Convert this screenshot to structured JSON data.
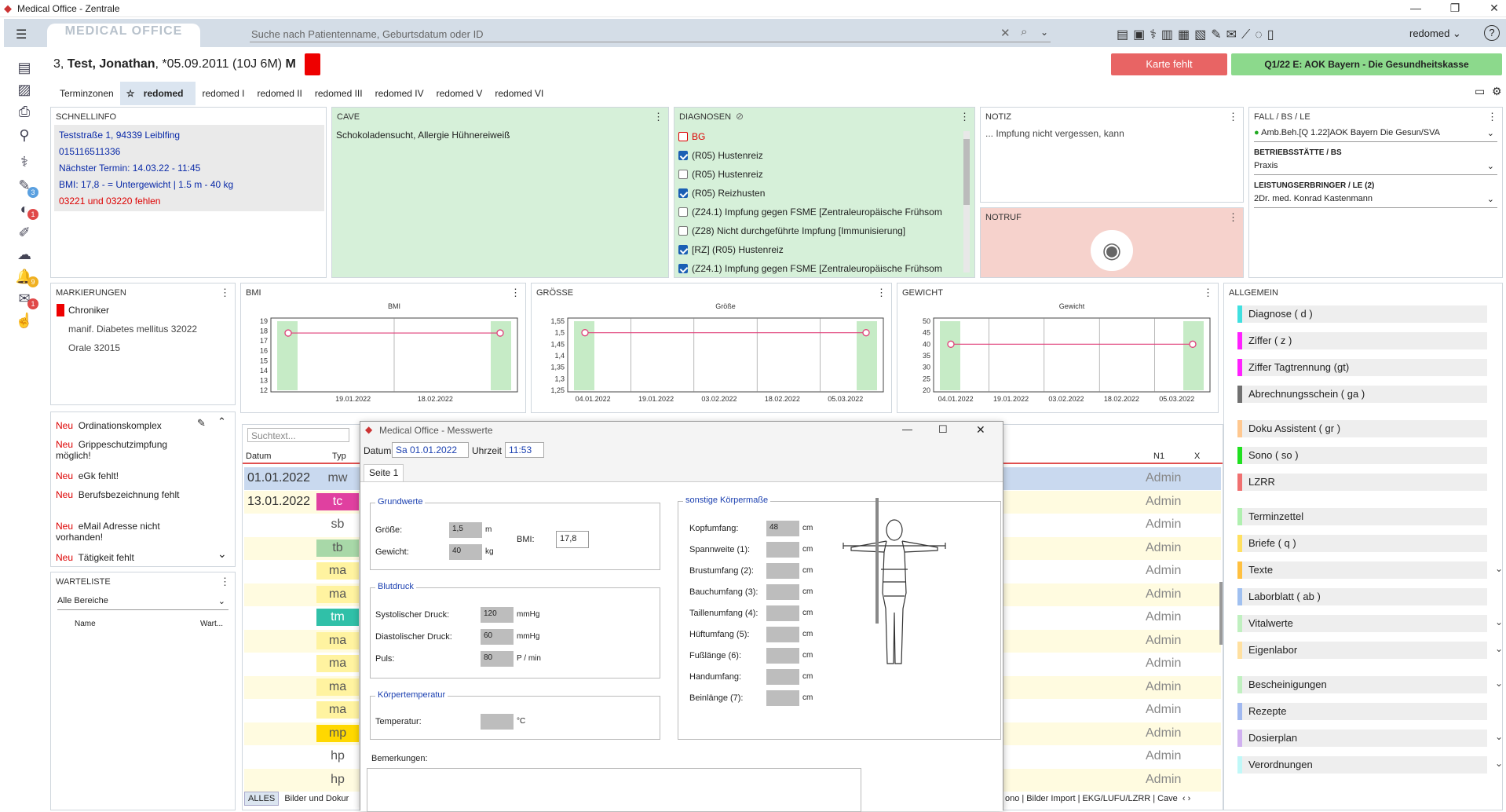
{
  "window": {
    "title": "Medical Office - Zentrale",
    "min": "—",
    "max": "❐",
    "close": "✕"
  },
  "appbar": {
    "menu_icon": "hamburger-icon",
    "logo": "MEDICAL OFFICE",
    "search_placeholder": "Suche nach Patientenname, Geburtsdatum oder ID",
    "user": "redomed ⌄",
    "help": "?"
  },
  "patient": {
    "num": "3,",
    "name": "Test, Jonathan",
    "dob": "*05.09.2011 (10J 6M)",
    "sex": "M",
    "karte": "Karte fehlt",
    "insurance": "Q1/22 E: AOK Bayern - Die Gesundheitskasse"
  },
  "tabs": [
    "Terminzonen",
    "redomed",
    "redomed I",
    "redomed II",
    "redomed III",
    "redomed IV",
    "redomed V",
    "redomed VI"
  ],
  "schnellinfo": {
    "title": "SCHNELLINFO",
    "l1": "Teststraße 1, 94339 Leiblfing",
    "l2": "015116511336",
    "l3": "Nächster Termin: 14.03.22 - 11:45",
    "l4": "BMI: 17,8 -  = Untergewicht | 1.5 m - 40 kg",
    "l5": "03221 und 03220 fehlen"
  },
  "cave": {
    "title": "CAVE",
    "text": "Schokoladensucht, Allergie Hühnereiweiß"
  },
  "diagnosen": {
    "title": "DIAGNOSEN",
    "items": [
      "BG",
      "(R05) Hustenreiz",
      "(R05) Hustenreiz",
      "(R05) Reizhusten",
      "(Z24.1) Impfung gegen FSME [Zentraleuropäische Frühsom",
      "(Z28) Nicht durchgeführte Impfung [Immunisierung]",
      "[RZ] (R05) Hustenreiz",
      "(Z24.1) Impfung gegen FSME [Zentraleuropäische Frühsom"
    ]
  },
  "notiz": {
    "title": "NOTIZ",
    "text": "... Impfung nicht vergessen, kann"
  },
  "notruf": {
    "title": "NOTRUF"
  },
  "fall": {
    "title": "FALL / BS / LE",
    "v1": "Amb.Beh.[Q 1.22]AOK Bayern Die Gesun/SVA",
    "bs_label": "BETRIEBSSTÄTTE / BS",
    "bs": "Praxis",
    "le_label": "LEISTUNGSERBRINGER / LE (2)",
    "le": "2Dr. med. Konrad Kastenmann"
  },
  "markierungen": {
    "title": "MARKIERUNGEN",
    "l1": "Chroniker",
    "l2": "manif. Diabetes mellitus  32022",
    "l3": "Orale  32015"
  },
  "charts": [
    {
      "title": "BMI",
      "inner": "BMI",
      "yticks": [
        "19",
        "18",
        "17",
        "16",
        "15",
        "14",
        "13",
        "12"
      ],
      "xticks": [
        "19.01.2022",
        "18.02.2022"
      ]
    },
    {
      "title": "GRÖßE",
      "inner": "Größe",
      "yticks": [
        "1,55",
        "1,5",
        "1,45",
        "1,4",
        "1,35",
        "1,3",
        "1,25"
      ],
      "xticks": [
        "04.01.2022",
        "19.01.2022",
        "03.02.2022",
        "18.02.2022",
        "05.03.2022"
      ]
    },
    {
      "title": "GEWICHT",
      "inner": "Gewicht",
      "yticks": [
        "50",
        "45",
        "40",
        "35",
        "30",
        "25",
        "20"
      ],
      "xticks": [
        "04.01.2022",
        "19.01.2022",
        "03.02.2022",
        "18.02.2022",
        "05.03.2022"
      ]
    }
  ],
  "chart_data": [
    {
      "type": "line",
      "title": "BMI",
      "y": [
        17.8,
        17.8
      ],
      "ylim": [
        12,
        19
      ]
    },
    {
      "type": "line",
      "title": "Größe",
      "y": [
        1.5,
        1.5
      ],
      "ylim": [
        1.25,
        1.55
      ]
    },
    {
      "type": "line",
      "title": "Gewicht",
      "y": [
        40,
        40
      ],
      "ylim": [
        20,
        50
      ]
    }
  ],
  "neu": [
    {
      "tag": "Neu",
      "text": "Ordinationskomplex"
    },
    {
      "tag": "Neu",
      "text": "Grippeschutzimpfung möglich!"
    },
    {
      "tag": "Neu",
      "text": "eGk fehlt!"
    },
    {
      "tag": "Neu",
      "text": "Berufsbezeichnung fehlt"
    },
    {
      "tag": "Neu",
      "text": "eMail Adresse nicht vorhanden!"
    },
    {
      "tag": "Neu",
      "text": "Tätigkeit fehlt"
    }
  ],
  "warteliste": {
    "title": "WARTELISTE",
    "filter": "Alle Bereiche",
    "col1": "Name",
    "col2": "Wart..."
  },
  "table": {
    "search": "Suchtext...",
    "h_datum": "Datum",
    "h_typ": "Typ",
    "h_n1": "N1",
    "h_x": "X",
    "rows": [
      {
        "d": "01.01.2022",
        "t": "mw",
        "a": "Admin",
        "c": ""
      },
      {
        "d": "13.01.2022",
        "t": "tc",
        "a": "Admin",
        "c": "#e040a0"
      },
      {
        "d": "",
        "t": "sb",
        "a": "Admin",
        "c": ""
      },
      {
        "d": "",
        "t": "tb",
        "a": "Admin",
        "c": "#a8d8a8"
      },
      {
        "d": "",
        "t": "ma",
        "a": "Admin",
        "c": "#fff3a0"
      },
      {
        "d": "",
        "t": "ma",
        "a": "Admin",
        "c": "#fff3a0"
      },
      {
        "d": "",
        "t": "tm",
        "a": "Admin",
        "c": "#30c0a8"
      },
      {
        "d": "",
        "t": "ma",
        "a": "Admin",
        "c": "#fff3a0"
      },
      {
        "d": "",
        "t": "ma",
        "a": "Admin",
        "c": "#fff3a0"
      },
      {
        "d": "",
        "t": "ma",
        "a": "Admin",
        "c": "#fff3a0"
      },
      {
        "d": "",
        "t": "ma",
        "a": "Admin",
        "c": "#fff3a0"
      },
      {
        "d": "",
        "t": "mp",
        "a": "Admin",
        "c": "#ffd800"
      },
      {
        "d": "",
        "t": "hp",
        "a": "Admin",
        "c": ""
      },
      {
        "d": "",
        "t": "hp",
        "a": "Admin",
        "c": ""
      }
    ],
    "bottom_tabs_left": [
      "ALLES",
      "Bilder und Dokur"
    ],
    "bottom_tabs_right": [
      "ono",
      "Bilder Import",
      "EKG/LUFU/LZRR",
      "Cave"
    ]
  },
  "allgemein": {
    "title": "ALLGEMEIN",
    "items": [
      {
        "l": "Diagnose ( d )",
        "c": "#40e0e0"
      },
      {
        "l": "Ziffer ( z )",
        "c": "#ff20ff"
      },
      {
        "l": "Ziffer Tagtrennung (gt)",
        "c": "#ff20ff"
      },
      {
        "l": "Abrechnungsschein ( ga )",
        "c": "#707070"
      },
      {
        "l": "Doku Assistent ( gr )",
        "c": "#ffc890"
      },
      {
        "l": "Sono ( so )",
        "c": "#20e020"
      },
      {
        "l": "LZRR",
        "c": "#f07070"
      },
      {
        "l": "Terminzettel",
        "c": "#b0f0b0"
      },
      {
        "l": "Briefe ( q )",
        "c": "#ffe060"
      },
      {
        "l": "Texte",
        "c": "#ffc040"
      },
      {
        "l": "Laborblatt ( ab )",
        "c": "#a0c0f0"
      },
      {
        "l": "Vitalwerte",
        "c": "#c0f0c0"
      },
      {
        "l": "Eigenlabor",
        "c": "#ffe0a0"
      },
      {
        "l": "Bescheinigungen",
        "c": "#c0f0c0"
      },
      {
        "l": "Rezepte",
        "c": "#a0b8f0"
      },
      {
        "l": "Dosierplan",
        "c": "#d0b0f0"
      },
      {
        "l": "Verordnungen",
        "c": "#c0f8f8"
      }
    ]
  },
  "dialog": {
    "title": "Medical Office - Messwerte",
    "datum_label": "Datum",
    "datum": "Sa  01.01.2022",
    "uhrzeit_label": "Uhrzeit",
    "uhrzeit": "11:53",
    "tab": "Seite 1",
    "grundwerte": "Grundwerte",
    "groesse_l": "Größe:",
    "groesse": "1,5",
    "groesse_u": "m",
    "gewicht_l": "Gewicht:",
    "gewicht": "40",
    "gewicht_u": "kg",
    "bmi_l": "BMI:",
    "bmi": "17,8",
    "blutdruck": "Blutdruck",
    "sys_l": "Systolischer Druck:",
    "sys": "120",
    "dia_l": "Diastolischer Druck:",
    "dia": "60",
    "puls_l": "Puls:",
    "puls": "80",
    "mmhg": "mmHg",
    "pmin": "P / min",
    "koerpertemp": "Körpertemperatur",
    "temp_l": "Temperatur:",
    "temp_u": "°C",
    "sonstige": "sonstige Körpermaße",
    "cm": "cm",
    "kopf": "48",
    "mass": [
      "Kopfumfang:",
      "Spannweite (1):",
      "Brustumfang (2):",
      "Bauchumfang (3):",
      "Taillenumfang (4):",
      "Hüftumfang (5):",
      "Fußlänge (6):",
      "Handumfang:",
      "Beinlänge (7):"
    ],
    "bemerkungen": "Bemerkungen:"
  }
}
